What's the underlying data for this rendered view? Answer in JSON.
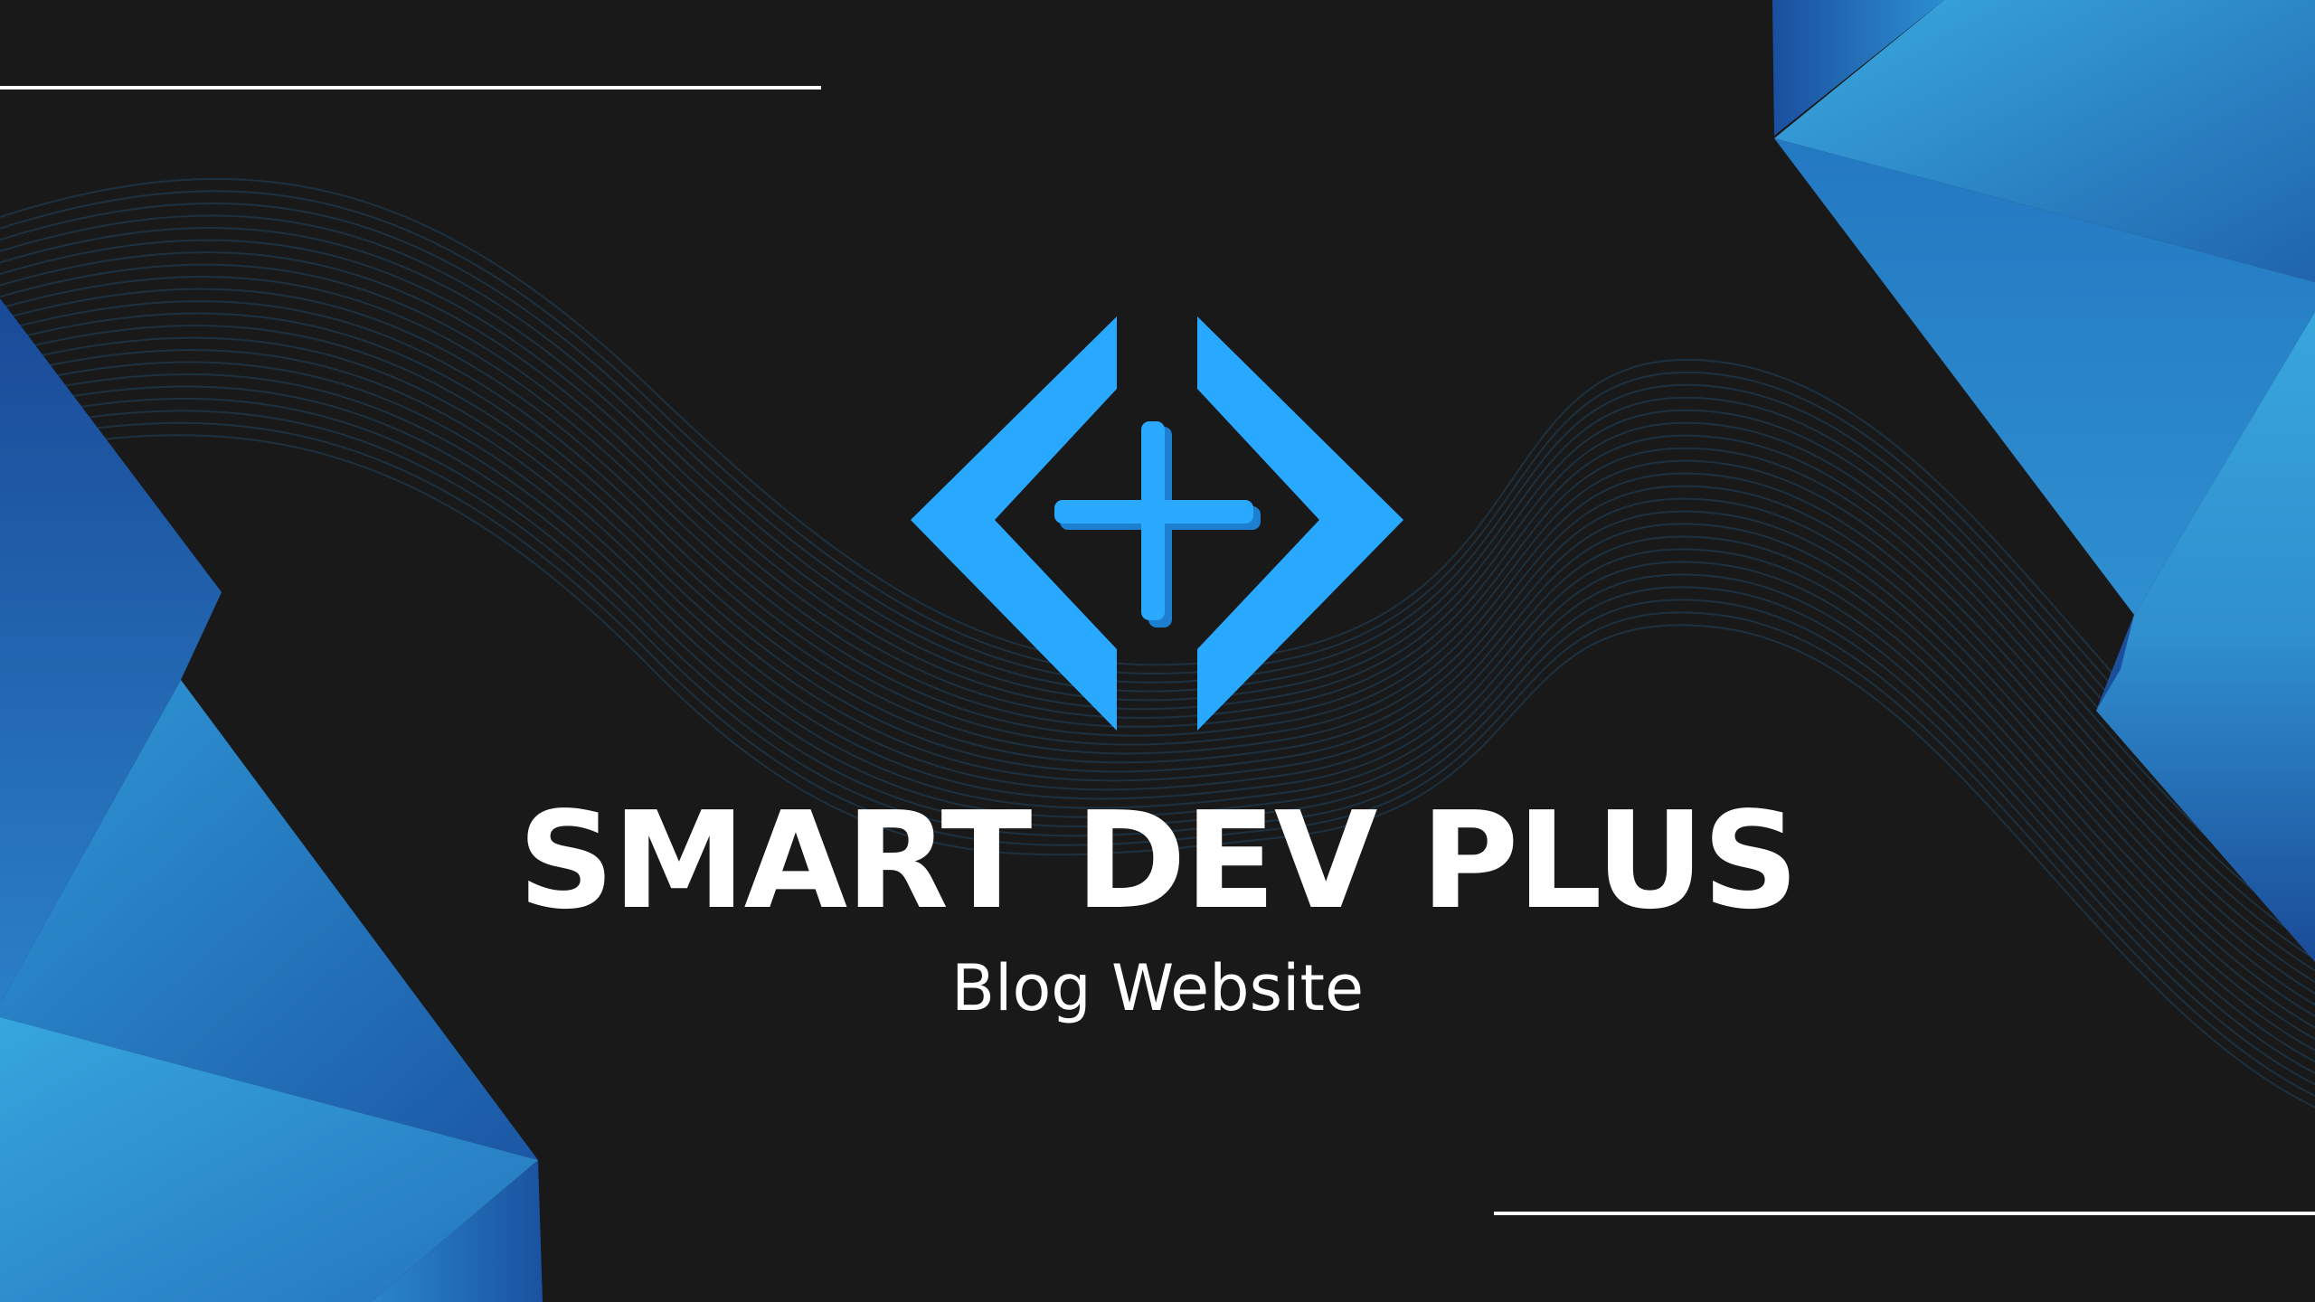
{
  "brand": {
    "title": "SMART DEV PLUS",
    "subtitle": "Blog Website",
    "logo_icon": "code-brackets-plus-logo"
  },
  "colors": {
    "background": "#191919",
    "accent": "#29a8ff",
    "accent_dark": "#1a5ea8",
    "accent_light": "#35a4de",
    "text": "#ffffff"
  }
}
